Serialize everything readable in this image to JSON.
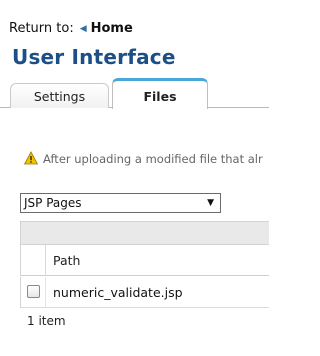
{
  "return_nav": {
    "prefix": "Return to:",
    "home_label": "Home",
    "icon": "triangle-left-icon"
  },
  "page_title": "User Interface",
  "tabs": [
    {
      "label": "Settings",
      "active": false
    },
    {
      "label": "Files",
      "active": true
    }
  ],
  "warning": {
    "icon": "warning-icon",
    "text": "After uploading a modified file that alr"
  },
  "file_type_select": {
    "selected": "JSP Pages"
  },
  "table": {
    "columns": [
      "",
      "Path"
    ],
    "rows": [
      {
        "checked": false,
        "path": "numeric_validate.jsp"
      }
    ],
    "count_text": "1 item"
  },
  "colors": {
    "title": "#1b4f85",
    "active_tab_accent": "#4aa7da",
    "home_arrow": "#2f6ea6",
    "warning_icon": "#f2c200"
  }
}
